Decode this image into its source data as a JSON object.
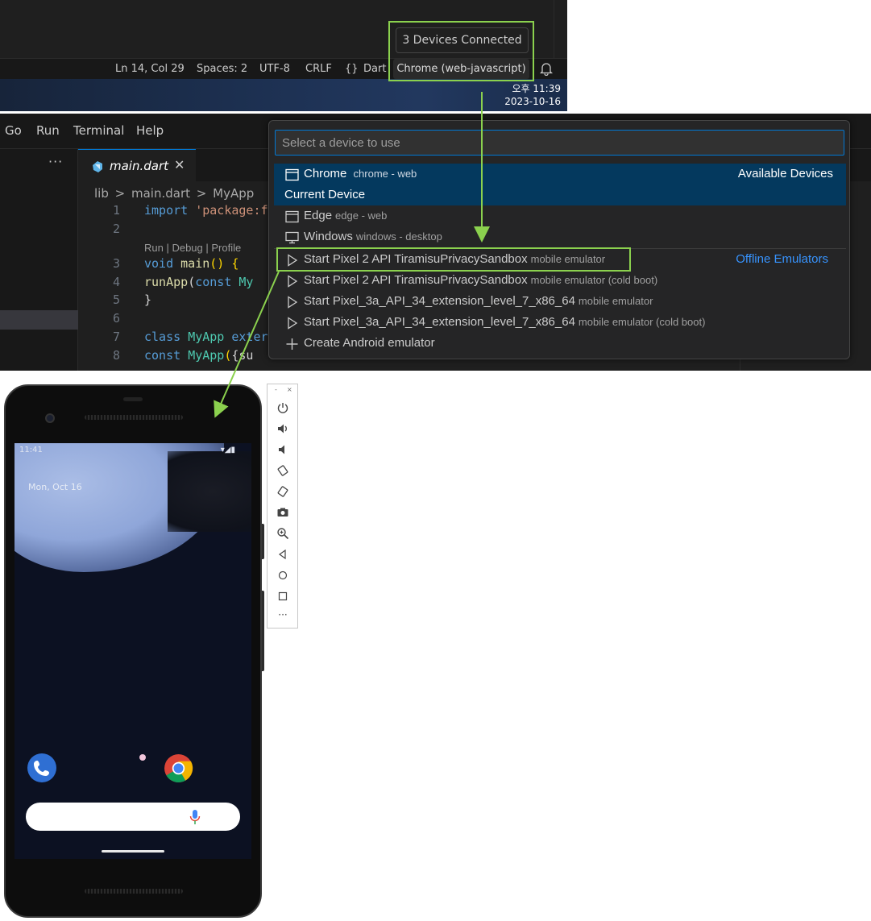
{
  "status_panel": {
    "tooltip": "3 Devices Connected",
    "statusbar": {
      "position": "Ln 14, Col 29",
      "indent": "Spaces: 2",
      "encoding": "UTF-8",
      "eol": "CRLF",
      "language_icon": "{}",
      "language": "Dart",
      "device": "Chrome (web-javascript)",
      "bell_icon": "bell-icon"
    },
    "taskbar": {
      "time": "오후 11:39",
      "date": "2023-10-16"
    }
  },
  "editor": {
    "menu": [
      "Go",
      "Run",
      "Terminal",
      "Help"
    ],
    "sidebar_more": "···",
    "tab": {
      "name": "main.dart",
      "close": "✕"
    },
    "breadcrumb": [
      "lib",
      ">",
      "main.dart",
      ">",
      "MyApp"
    ],
    "codelens": "Run | Debug | Profile",
    "code_lines": [
      {
        "num": "1",
        "text": "import 'package:f"
      },
      {
        "num": "2",
        "text": ""
      },
      {
        "num": "3",
        "text": "void main() {"
      },
      {
        "num": "4",
        "text": "  runApp(const My"
      },
      {
        "num": "5",
        "text": "}"
      },
      {
        "num": "6",
        "text": ""
      },
      {
        "num": "7",
        "text": "class MyApp exter"
      },
      {
        "num": "8",
        "text": "  const MyApp({su"
      }
    ]
  },
  "quick_pick": {
    "placeholder": "Select a device to use",
    "selected": {
      "label": "Chrome",
      "description": "chrome - web",
      "group": "Available Devices",
      "detail": "Current Device"
    },
    "items": [
      {
        "label": "Edge",
        "description": "edge - web",
        "icon": "browser-icon"
      },
      {
        "label": "Windows",
        "description": "windows - desktop",
        "icon": "monitor-icon"
      },
      {
        "label": "Start Pixel 2 API TiramisuPrivacySandbox",
        "description": "mobile emulator",
        "icon": "play-icon",
        "group": "Offline Emulators"
      },
      {
        "label": "Start Pixel 2 API TiramisuPrivacySandbox",
        "description": "mobile emulator (cold boot)",
        "icon": "play-icon"
      },
      {
        "label": "Start Pixel_3a_API_34_extension_level_7_x86_64",
        "description": "mobile emulator",
        "icon": "play-icon"
      },
      {
        "label": "Start Pixel_3a_API_34_extension_level_7_x86_64",
        "description": "mobile emulator (cold boot)",
        "icon": "play-icon"
      },
      {
        "label": "Create Android emulator",
        "description": "",
        "icon": "plus-icon"
      }
    ]
  },
  "emulator": {
    "status_time": "11:41",
    "date": "Mon, Oct 16",
    "toolbar_window_controls": [
      "-",
      "×"
    ],
    "toolbar": [
      "power-icon",
      "volume-up-icon",
      "volume-down-icon",
      "rotate-left-icon",
      "rotate-right-icon",
      "camera-icon",
      "zoom-icon",
      "back-icon",
      "home-icon",
      "overview-icon",
      "more-icon"
    ],
    "more_label": "···"
  },
  "colors": {
    "accent_green": "#8bd14e",
    "vscode_blue": "#0078d4",
    "selected_bg": "#04395e",
    "group_link": "#3794ff"
  }
}
